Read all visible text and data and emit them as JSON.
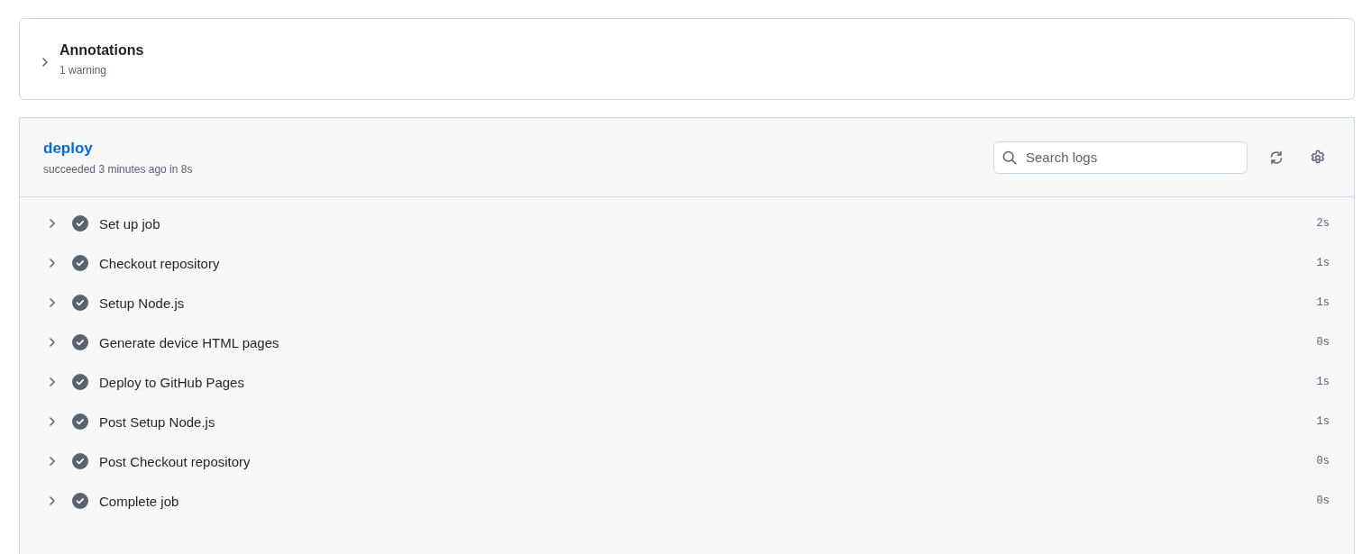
{
  "annotations": {
    "title": "Annotations",
    "summary": "1 warning",
    "expanded": false
  },
  "job": {
    "name": "deploy",
    "status_text": "succeeded 3 minutes ago in 8s",
    "search": {
      "placeholder": "Search logs"
    },
    "steps": [
      {
        "name": "Set up job",
        "duration": "2s",
        "succeeded": true,
        "expanded": false
      },
      {
        "name": "Checkout repository",
        "duration": "1s",
        "succeeded": true,
        "expanded": false
      },
      {
        "name": "Setup Node.js",
        "duration": "1s",
        "succeeded": true,
        "expanded": false
      },
      {
        "name": "Generate device HTML pages",
        "duration": "0s",
        "succeeded": true,
        "expanded": false
      },
      {
        "name": "Deploy to GitHub Pages",
        "duration": "1s",
        "succeeded": true,
        "expanded": false
      },
      {
        "name": "Post Setup Node.js",
        "duration": "1s",
        "succeeded": true,
        "expanded": false
      },
      {
        "name": "Post Checkout repository",
        "duration": "0s",
        "succeeded": true,
        "expanded": false
      },
      {
        "name": "Complete job",
        "duration": "0s",
        "succeeded": true,
        "expanded": false
      }
    ]
  }
}
